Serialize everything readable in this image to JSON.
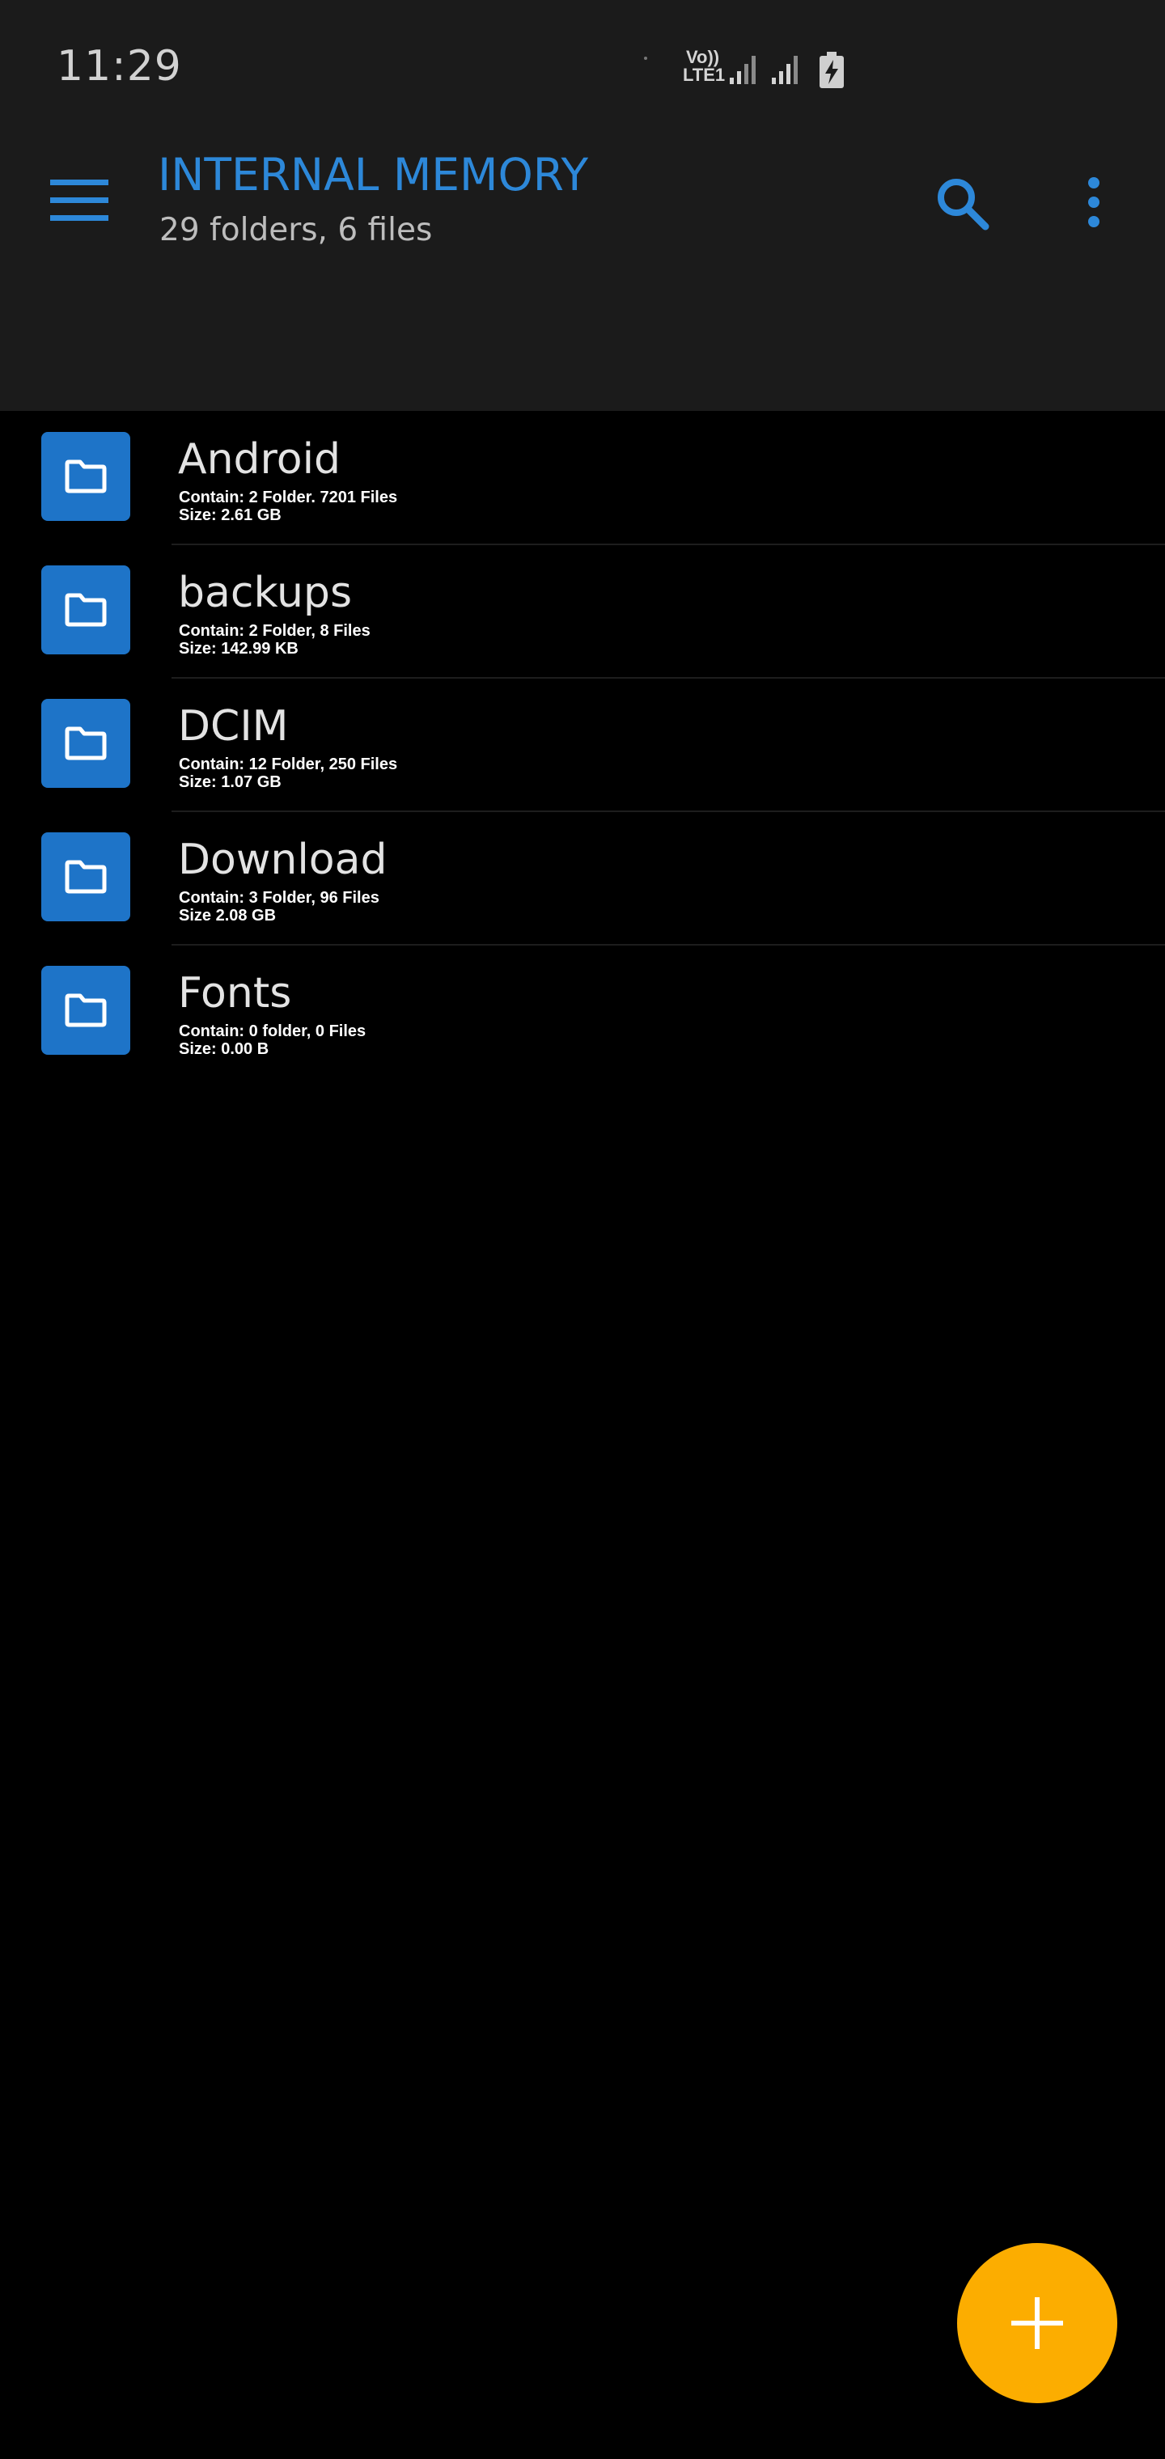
{
  "status_bar": {
    "time": "11:29",
    "volte_top": "Vo))",
    "volte_bottom": "LTE1"
  },
  "toolbar": {
    "title": "INTERNAL MEMORY",
    "subtitle": "29 folders, 6 files"
  },
  "colors": {
    "accent": "#2d88d9",
    "folder_icon_bg": "#1e74c8",
    "fab": "#fcad00",
    "toolbar_bg": "#1b1b1b",
    "list_bg": "#000000"
  },
  "icons": {
    "menu": "hamburger-menu-icon",
    "search": "search-icon",
    "more": "more-vertical-icon",
    "folder": "folder-icon",
    "fab": "plus-icon"
  },
  "folders": [
    {
      "name": "Android",
      "contain": "Contain: 2 Folder. 7201 Files",
      "size": "Size: 2.61 GB"
    },
    {
      "name": "backups",
      "contain": "Contain: 2 Folder, 8 Files",
      "size": "Size: 142.99 KB"
    },
    {
      "name": "DCIM",
      "contain": "Contain: 12 Folder, 250 Files",
      "size": "Size: 1.07 GB"
    },
    {
      "name": "Download",
      "contain": "Contain: 3 Folder, 96 Files",
      "size": "Size 2.08 GB"
    },
    {
      "name": "Fonts",
      "contain": "Contain: 0 folder, 0 Files",
      "size": "Size: 0.00 B"
    }
  ]
}
